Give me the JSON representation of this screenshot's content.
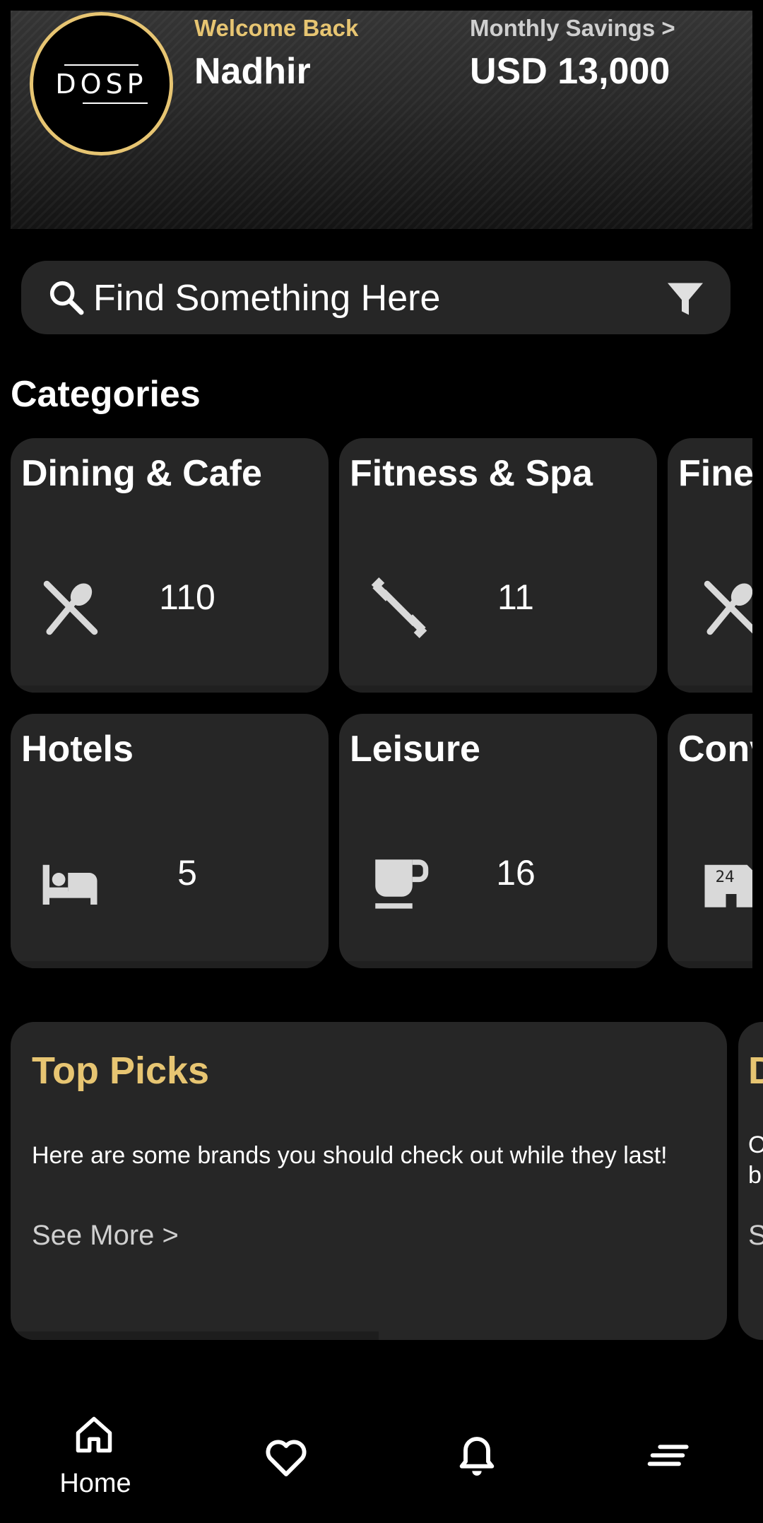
{
  "header": {
    "logo_text": "DOSP",
    "welcome": "Welcome Back",
    "username": "Nadhir",
    "savings_link": "Monthly Savings >",
    "savings_value": "USD 13,000"
  },
  "search": {
    "placeholder": "Find Something Here",
    "icon": "search-icon",
    "filter_icon": "filter-icon"
  },
  "categories": {
    "title": "Categories",
    "items": [
      {
        "label": "Dining & Cafe",
        "count": "110",
        "icon": "fork-spoon-icon"
      },
      {
        "label": "Fitness & Spa",
        "count": "11",
        "icon": "dumbbell-icon"
      },
      {
        "label": "Fine",
        "count": "",
        "icon": "fork-spoon-icon"
      },
      {
        "label": "Hotels",
        "count": "5",
        "icon": "bed-icon"
      },
      {
        "label": "Leisure",
        "count": "16",
        "icon": "coffee-cup-icon"
      },
      {
        "label": "Conv",
        "count": "",
        "icon": "store-24h-icon"
      }
    ]
  },
  "promos": [
    {
      "title": "Top Picks",
      "description": "Here are some brands you should check out while they last!",
      "link": "See More >",
      "progress": 0.5
    },
    {
      "title": "D",
      "description": "O",
      "description2": "b",
      "link": "S"
    }
  ],
  "bottom_nav": {
    "items": [
      {
        "label": "Home",
        "icon": "home-icon",
        "active": true
      },
      {
        "label": "",
        "icon": "heart-icon"
      },
      {
        "label": "",
        "icon": "bell-icon"
      },
      {
        "label": "",
        "icon": "menu-icon"
      }
    ]
  },
  "colors": {
    "accent_gold": "#e7c572",
    "card_bg": "#262626",
    "background": "#000000",
    "icon_gray": "#d9d9d9"
  }
}
